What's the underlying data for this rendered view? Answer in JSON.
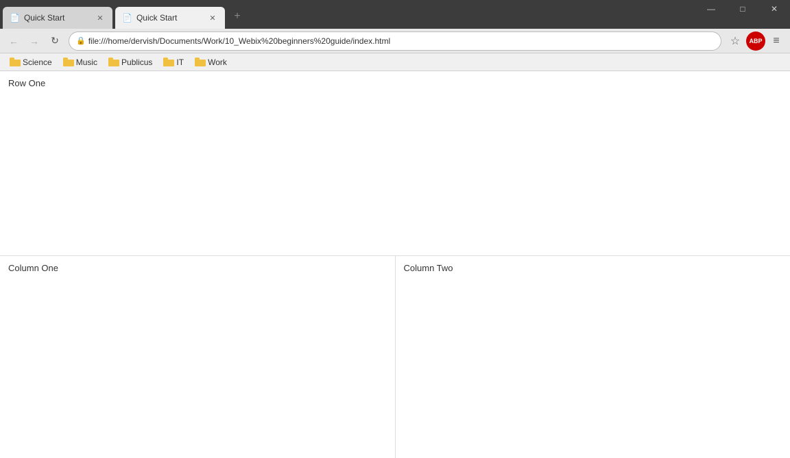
{
  "titlebar": {
    "tabs": [
      {
        "id": "tab1",
        "label": "Quick Start",
        "active": false,
        "icon": "📄"
      },
      {
        "id": "tab2",
        "label": "Quick Start",
        "active": true,
        "icon": "📄"
      }
    ],
    "controls": {
      "minimize": "—",
      "maximize": "□",
      "close": "✕"
    }
  },
  "navbar": {
    "back_title": "Back",
    "forward_title": "Forward",
    "reload_title": "Reload",
    "address": "file:///home/dervish/Documents/Work/10_Webix%20beginners%20guide/index.html",
    "star_title": "Bookmark",
    "abp_label": "ABP",
    "menu_title": "Menu"
  },
  "bookmarks": {
    "items": [
      {
        "label": "Science"
      },
      {
        "label": "Music"
      },
      {
        "label": "Publicus"
      },
      {
        "label": "IT"
      },
      {
        "label": "Work"
      }
    ]
  },
  "page": {
    "row_one_label": "Row One",
    "column_one_label": "Column One",
    "column_two_label": "Column Two"
  }
}
